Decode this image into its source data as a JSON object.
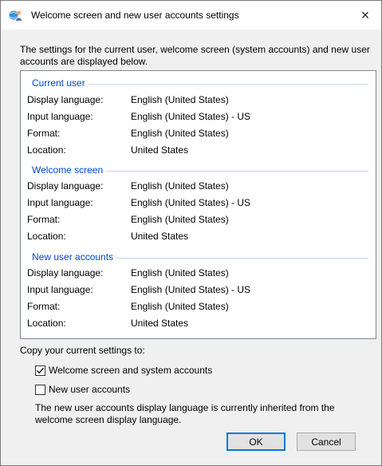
{
  "window": {
    "title": "Welcome screen and new user accounts settings",
    "close_glyph": "×"
  },
  "intro": "The settings for the current user, welcome screen (system accounts) and new user accounts are displayed below.",
  "groups": [
    {
      "title": "Current user",
      "rows": [
        {
          "label": "Display language:",
          "value": "English (United States)"
        },
        {
          "label": "Input language:",
          "value": "English (United States) - US"
        },
        {
          "label": "Format:",
          "value": "English (United States)"
        },
        {
          "label": "Location:",
          "value": "United States"
        }
      ]
    },
    {
      "title": "Welcome screen",
      "rows": [
        {
          "label": "Display language:",
          "value": "English (United States)"
        },
        {
          "label": "Input language:",
          "value": "English (United States) - US"
        },
        {
          "label": "Format:",
          "value": "English (United States)"
        },
        {
          "label": "Location:",
          "value": "United States"
        }
      ]
    },
    {
      "title": "New user accounts",
      "rows": [
        {
          "label": "Display language:",
          "value": "English (United States)"
        },
        {
          "label": "Input language:",
          "value": "English (United States) - US"
        },
        {
          "label": "Format:",
          "value": "English (United States)"
        },
        {
          "label": "Location:",
          "value": "United States"
        }
      ]
    }
  ],
  "copy": {
    "label": "Copy your current settings to:",
    "welcome_checkbox": {
      "label": "Welcome screen and system accounts",
      "checked": true
    },
    "new_users_checkbox": {
      "label": "New user accounts",
      "checked": false
    }
  },
  "note": "The new user accounts display language is currently inherited from the welcome screen display language.",
  "buttons": {
    "ok": "OK",
    "cancel": "Cancel"
  },
  "colors": {
    "group_header": "#0046d5",
    "default_button_border": "#0078d7"
  },
  "icons": {
    "title": "globe-people-icon",
    "close": "close-icon",
    "check": "checkmark-icon"
  }
}
